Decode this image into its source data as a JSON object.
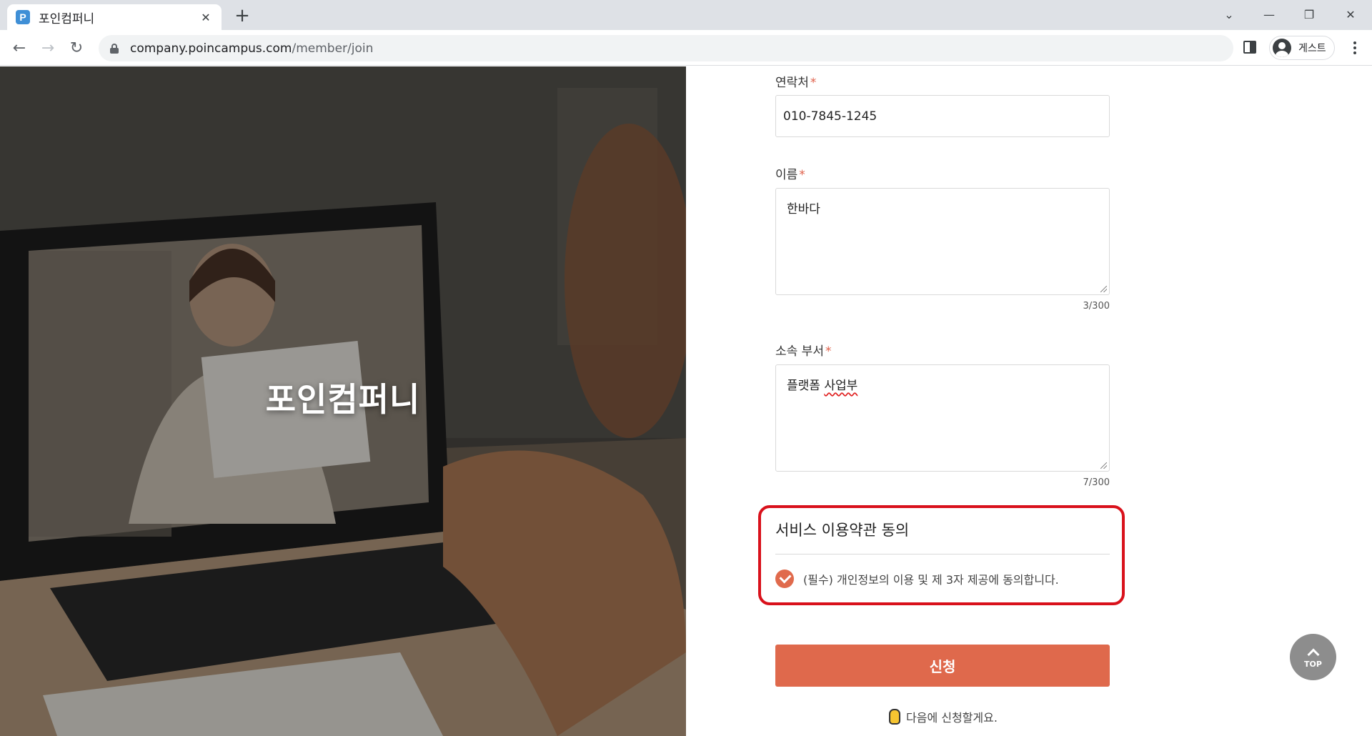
{
  "browser": {
    "tab_title": "포인컴퍼니",
    "favicon_letter": "P",
    "url_host": "company.poincampus.com",
    "url_path": "/member/join",
    "profile_label": "게스트"
  },
  "hero": {
    "title": "포인컴퍼니"
  },
  "form": {
    "contact": {
      "label": "연락처",
      "required_mark": "*",
      "value": "010-7845-1245"
    },
    "name": {
      "label": "이름",
      "required_mark": "*",
      "value": "한바다",
      "counter": "3/300"
    },
    "department": {
      "label": "소속 부서",
      "required_mark": "*",
      "value_plain": "플랫폼 ",
      "value_flagged": "사업부",
      "counter": "7/300"
    }
  },
  "terms": {
    "title": "서비스 이용약관 동의",
    "item_label": "(필수) 개인정보의 이용 및 제 3자 제공에 동의합니다.",
    "checked": true
  },
  "actions": {
    "submit_label": "신청",
    "later_label": "다음에 신청할게요."
  },
  "top_button": {
    "label": "TOP"
  },
  "colors": {
    "accent": "#df694c",
    "highlight_border": "#d9111b",
    "required": "#e0604a"
  }
}
